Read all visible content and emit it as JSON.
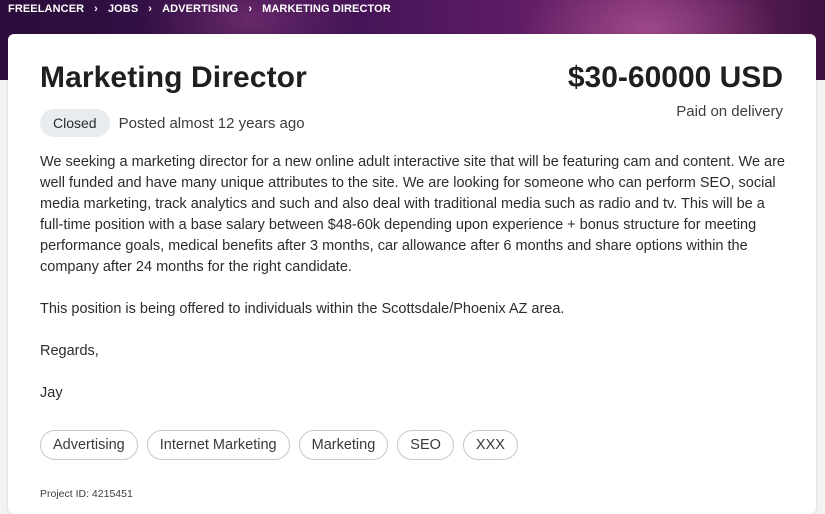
{
  "breadcrumb": {
    "items": [
      "FREELANCER",
      "JOBS",
      "ADVERTISING",
      "MARKETING DIRECTOR"
    ]
  },
  "job": {
    "title": "Marketing Director",
    "budget": "$30-60000 USD",
    "payment_terms": "Paid on delivery",
    "status": "Closed",
    "posted": "Posted almost 12 years ago",
    "description": [
      "We seeking a marketing director for a new online adult interactive site that will be featuring cam and content. We are well funded and have many unique attributes to the site. We are looking for someone who can perform SEO, social media marketing, track analytics and such and also deal with traditional media such as radio and tv. This will be a full-time position with a base salary between $48-60k depending upon experience + bonus structure for meeting performance goals, medical benefits after 3 months, car allowance after 6 months and share options within the company after 24 months for the right candidate.",
      "This position is being offered to individuals within the Scottsdale/Phoenix AZ area.",
      "Regards,",
      "Jay"
    ],
    "tags": [
      "Advertising",
      "Internet Marketing",
      "Marketing",
      "SEO",
      "XXX"
    ],
    "project_id": "Project ID: 4215451"
  }
}
